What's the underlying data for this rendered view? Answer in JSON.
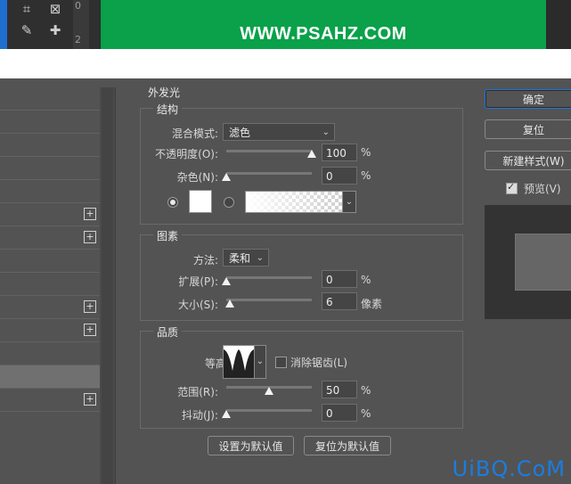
{
  "banner": {
    "text": "WWW.PSAHZ.COM"
  },
  "ruler": {
    "t1": "0",
    "t2": "2"
  },
  "style_list": {
    "rows": [
      {
        "plus": false
      },
      {
        "plus": false
      },
      {
        "plus": false
      },
      {
        "plus": false
      },
      {
        "plus": false
      },
      {
        "plus": true
      },
      {
        "plus": true
      },
      {
        "plus": false
      },
      {
        "plus": false
      },
      {
        "plus": true
      },
      {
        "plus": true
      },
      {
        "plus": false
      },
      {
        "plus": false,
        "selected": true
      },
      {
        "plus": true
      }
    ]
  },
  "panel": {
    "title": "外发光",
    "structure": {
      "title": "结构",
      "blend_label": "混合模式:",
      "blend_value": "滤色",
      "opacity_label": "不透明度(O):",
      "opacity_value": "100",
      "opacity_unit": "%",
      "opacity_level": 1.0,
      "noise_label": "杂色(N):",
      "noise_value": "0",
      "noise_unit": "%",
      "noise_level": 0.0
    },
    "elements": {
      "title": "图素",
      "method_label": "方法:",
      "method_value": "柔和",
      "spread_label": "扩展(P):",
      "spread_value": "0",
      "spread_unit": "%",
      "spread_level": 0.0,
      "size_label": "大小(S):",
      "size_value": "6",
      "size_unit": "像素",
      "size_level": 0.04
    },
    "quality": {
      "title": "品质",
      "contour_label": "等高线:",
      "antialias_label": "消除锯齿(L)",
      "range_label": "范围(R):",
      "range_value": "50",
      "range_unit": "%",
      "range_level": 0.5,
      "jitter_label": "抖动(J):",
      "jitter_value": "0",
      "jitter_unit": "%",
      "jitter_level": 0.0
    },
    "set_default": "设置为默认值",
    "reset_default": "复位为默认值"
  },
  "buttons": {
    "ok": "确定",
    "reset": "复位",
    "new_style": "新建样式(W)",
    "preview_label": "预览(V)"
  },
  "watermark": "UiBQ.CoM",
  "colors": {
    "accent": "#1f77e0",
    "banner": "#0aa14a"
  }
}
